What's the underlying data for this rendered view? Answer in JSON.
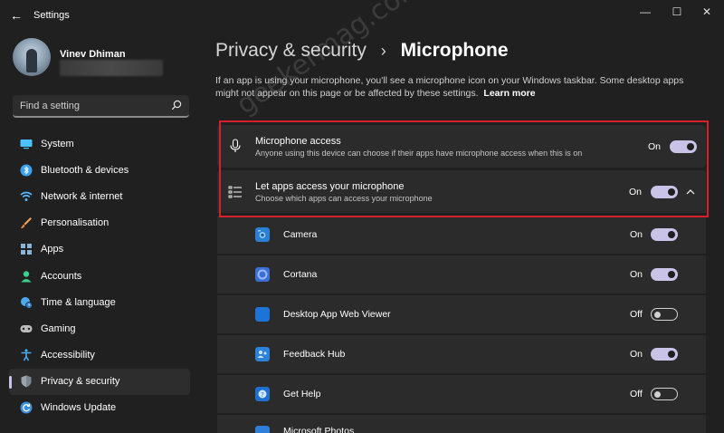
{
  "window": {
    "title": "Settings",
    "back_glyph": "←",
    "minimize_glyph": "—",
    "maximize_glyph": "☐",
    "close_glyph": "✕"
  },
  "user": {
    "name": "Vinev Dhiman"
  },
  "search": {
    "placeholder": "Find a setting",
    "icon": "search-icon"
  },
  "sidebar": {
    "items": [
      {
        "label": "System",
        "icon": "system-icon",
        "color": "#4cc2ff"
      },
      {
        "label": "Bluetooth & devices",
        "icon": "bluetooth-icon",
        "color": "#3aa0f3"
      },
      {
        "label": "Network & internet",
        "icon": "wifi-icon",
        "color": "#56b7ff"
      },
      {
        "label": "Personalisation",
        "icon": "brush-icon",
        "color": "#f0a05a"
      },
      {
        "label": "Apps",
        "icon": "apps-icon",
        "color": "#8ab4d8"
      },
      {
        "label": "Accounts",
        "icon": "account-icon",
        "color": "#3ccf8a"
      },
      {
        "label": "Time & language",
        "icon": "globe-clock-icon",
        "color": "#4aa9f0"
      },
      {
        "label": "Gaming",
        "icon": "controller-icon",
        "color": "#bdbdbd"
      },
      {
        "label": "Accessibility",
        "icon": "accessibility-icon",
        "color": "#4aa9f0"
      },
      {
        "label": "Privacy & security",
        "icon": "shield-icon",
        "color": "#9aa4ad",
        "active": true
      },
      {
        "label": "Windows Update",
        "icon": "update-icon",
        "color": "#3b8fe0"
      }
    ]
  },
  "header": {
    "parent": "Privacy & security",
    "separator": "›",
    "current": "Microphone"
  },
  "description": {
    "text": "If an app is using your microphone, you'll see a microphone icon on your Windows taskbar. Some desktop apps might not appear on this page or be affected by these settings.",
    "link": "Learn more"
  },
  "microphone_access": {
    "title": "Microphone access",
    "subtitle": "Anyone using this device can choose if their apps have microphone access when this is on",
    "state_label": "On",
    "on": true,
    "icon": "microphone-icon"
  },
  "let_apps": {
    "title": "Let apps access your microphone",
    "subtitle": "Choose which apps can access your microphone",
    "state_label": "On",
    "on": true,
    "icon": "list-icon",
    "chevron": "chevron-up-icon"
  },
  "apps": [
    {
      "name": "Camera",
      "state_label": "On",
      "on": true,
      "color": "#2b7fd4"
    },
    {
      "name": "Cortana",
      "state_label": "On",
      "on": true,
      "color": "#3b6fd8"
    },
    {
      "name": "Desktop App Web Viewer",
      "state_label": "Off",
      "on": false,
      "color": "#1e73d6"
    },
    {
      "name": "Feedback Hub",
      "state_label": "On",
      "on": true,
      "color": "#2a82db"
    },
    {
      "name": "Get Help",
      "state_label": "Off",
      "on": false,
      "color": "#1f6fcf"
    },
    {
      "name": "Microsoft Photos",
      "state_label": "",
      "on": true,
      "color": "#2f7fd8"
    }
  ],
  "watermark": "geekermag.com",
  "accent": "#c9c3e8",
  "highlight_color": "#d6202c"
}
